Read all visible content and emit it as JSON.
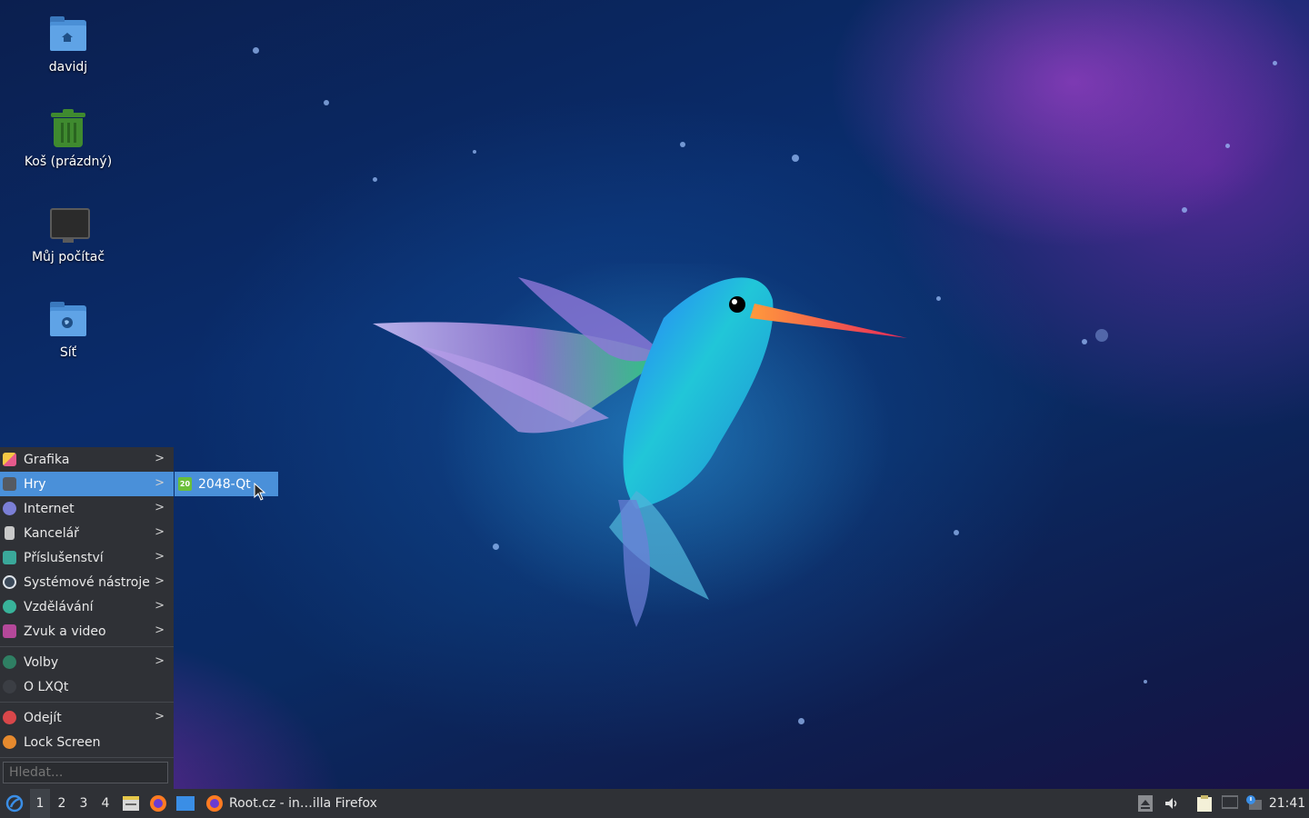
{
  "desktop": {
    "icons": [
      {
        "label": "davidj",
        "icon": "home-folder-icon"
      },
      {
        "label": "Koš (prázdný)",
        "icon": "trash-icon"
      },
      {
        "label": "Můj počítač",
        "icon": "computer-icon"
      },
      {
        "label": "Síť",
        "icon": "network-folder-icon"
      }
    ]
  },
  "menu": {
    "categories": [
      {
        "label": "Grafika",
        "icon": "graphics-icon"
      },
      {
        "label": "Hry",
        "icon": "games-icon",
        "highlighted": true
      },
      {
        "label": "Internet",
        "icon": "internet-icon"
      },
      {
        "label": "Kancelář",
        "icon": "office-icon"
      },
      {
        "label": "Příslušenství",
        "icon": "accessories-icon"
      },
      {
        "label": "Systémové nástroje",
        "icon": "system-tools-icon"
      },
      {
        "label": "Vzdělávání",
        "icon": "education-icon"
      },
      {
        "label": "Zvuk a video",
        "icon": "multimedia-icon"
      }
    ],
    "settings_label": "Volby",
    "about_label": "O LXQt",
    "leave_label": "Odejít",
    "lock_label": "Lock Screen",
    "search_placeholder": "Hledat..."
  },
  "submenu": {
    "items": [
      {
        "label": "2048-Qt",
        "icon": "2048-qt-icon"
      }
    ]
  },
  "taskbar": {
    "desktops": [
      "1",
      "2",
      "3",
      "4"
    ],
    "active_desktop": "1",
    "window_title": "Root.cz - in…illa Firefox",
    "clock": "21:41"
  },
  "colors": {
    "highlight": "#4a90d9",
    "panel": "#2f3136"
  }
}
